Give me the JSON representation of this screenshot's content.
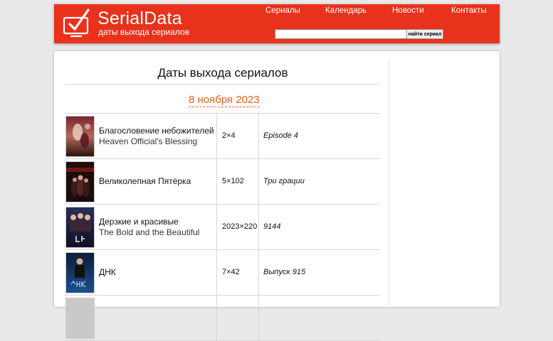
{
  "header": {
    "logo_title": "SerialData",
    "logo_subtitle": "даты выхода сериалов",
    "nav": [
      "Сериалы",
      "Календарь",
      "Новости",
      "Контакты"
    ],
    "search": {
      "placeholder": "",
      "value": "",
      "button_label": "найти сериал"
    },
    "brand_color": "#e8321c"
  },
  "main": {
    "page_title": "Даты выхода сериалов",
    "date_heading": "8 ноября 2023",
    "date_color": "#e8601c",
    "rows": [
      {
        "title_ru": "Благословение небожителей",
        "title_en": "Heaven Official's Blessing",
        "episode": "2×4",
        "episode_title": "Episode 4"
      },
      {
        "title_ru": "Великолепная Пятёрка",
        "title_en": "",
        "episode": "5×102",
        "episode_title": "Три грации"
      },
      {
        "title_ru": "Дерзкие и красивые",
        "title_en": "The Bold and the Beautiful",
        "episode": "2023×220",
        "episode_title": "9144"
      },
      {
        "title_ru": "ДНК",
        "title_en": "",
        "episode": "7×42",
        "episode_title": "Выпуск 915"
      }
    ]
  },
  "icons": {
    "logo": "tv-checkmark-icon"
  }
}
